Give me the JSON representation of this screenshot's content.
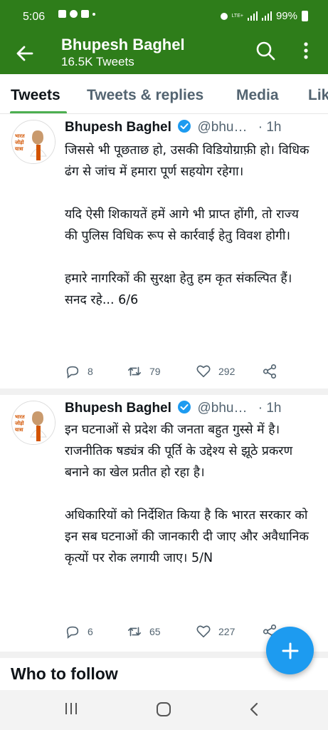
{
  "status_bar": {
    "time": "5:06",
    "network": "LTE+",
    "battery": "99%"
  },
  "header": {
    "title": "Bhupesh Baghel",
    "subtitle": "16.5K Tweets"
  },
  "tabs": [
    {
      "label": "Tweets"
    },
    {
      "label": "Tweets & replies"
    },
    {
      "label": "Media"
    },
    {
      "label": "Lik"
    }
  ],
  "tweets": [
    {
      "avatar_text": "भारत जोड़ो यात्रा",
      "name": "Bhupesh Baghel",
      "handle": "@bhu…",
      "time": "· 1h",
      "text": "जिससे भी पूछताछ हो, उसकी विडियोग्राफ़ी हो। विधिक ढंग से जांच में हमारा पूर्ण सहयोग रहेगा।\n\nयदि ऐसी शिकायतें हमें आगे भी प्राप्त होंगी, तो राज्य की पुलिस विधिक रूप से कार्रवाई हेतु विवश होगी।\n\nहमारे नागरिकों की सुरक्षा हेतु हम कृत संकल्पित हैं। सनद रहे... 6/6",
      "replies": "8",
      "retweets": "79",
      "likes": "292"
    },
    {
      "avatar_text": "भारत जोड़ो यात्रा",
      "name": "Bhupesh Baghel",
      "handle": "@bhu…",
      "time": "· 1h",
      "text": "इन घटनाओं से प्रदेश की जनता बहुत गुस्से में है। राजनीतिक षड्यंत्र की पूर्ति के उद्देश्य से झूठे प्रकरण बनाने का खेल प्रतीत हो रहा है।\n\nअधिकारियों को निर्देशित किया है कि भारत सरकार को इन सब घटनाओं की जानकारी दी जाए और अवैधानिक कृत्यों पर रोक लगायी जाए। 5/N",
      "replies": "6",
      "retweets": "65",
      "likes": "227"
    }
  ],
  "section_title": "Who to follow",
  "colors": {
    "header_bg": "#2e7d1a",
    "accent": "#4caf50",
    "fab": "#1d9bf0",
    "verified": "#1d9bf0"
  },
  "icons": [
    "back-arrow-icon",
    "search-icon",
    "more-vertical-icon",
    "verified-badge-icon",
    "reply-icon",
    "retweet-icon",
    "like-icon",
    "share-icon",
    "compose-plus-icon"
  ]
}
